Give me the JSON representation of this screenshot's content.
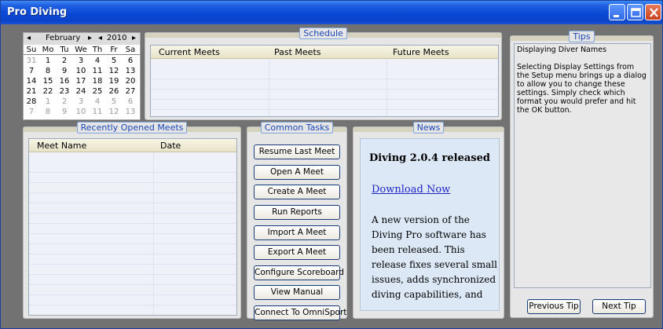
{
  "window": {
    "title": "Pro Diving"
  },
  "calendar": {
    "month": "February",
    "year": "2010",
    "prev_month": "◂",
    "next_month": "▸",
    "prev_year": "◂",
    "next_year": "▸",
    "weekdays": [
      "Su",
      "Mo",
      "Tu",
      "We",
      "Th",
      "Fr",
      "Sa"
    ],
    "weeks": [
      [
        "31",
        "1",
        "2",
        "3",
        "4",
        "5",
        "6"
      ],
      [
        "7",
        "8",
        "9",
        "10",
        "11",
        "12",
        "13"
      ],
      [
        "14",
        "15",
        "16",
        "17",
        "18",
        "19",
        "20"
      ],
      [
        "21",
        "22",
        "23",
        "24",
        "25",
        "26",
        "27"
      ],
      [
        "28",
        "1",
        "2",
        "3",
        "4",
        "5",
        "6"
      ],
      [
        "7",
        "8",
        "9",
        "10",
        "11",
        "12",
        "13"
      ]
    ]
  },
  "schedule": {
    "caption": "Schedule",
    "columns": [
      "Current Meets",
      "Past Meets",
      "Future Meets"
    ]
  },
  "recent": {
    "caption": "Recently Opened Meets",
    "columns": [
      "Meet Name",
      "Date"
    ]
  },
  "tasks": {
    "caption": "Common Tasks",
    "buttons": [
      "Resume Last Meet",
      "Open A Meet",
      "Create A Meet",
      "Run Reports",
      "Import A Meet",
      "Export A Meet",
      "Configure Scoreboard",
      "View Manual",
      "Connect To OmniSport"
    ]
  },
  "news": {
    "caption": "News",
    "headline": "Diving 2.0.4 released",
    "link": "Download Now",
    "body": "A new version of the Diving Pro software has been released. This release fixes several small issues, adds synchronized diving capabilities, and"
  },
  "tips": {
    "caption": "Tips",
    "title": "Displaying Diver Names",
    "text": "Selecting Display Settings from the Setup menu brings up a dialog to allow you to change these settings. Simply check which format you would prefer and hit the OK button.",
    "prev_label": "Previous Tip",
    "next_label": "Next Tip"
  }
}
